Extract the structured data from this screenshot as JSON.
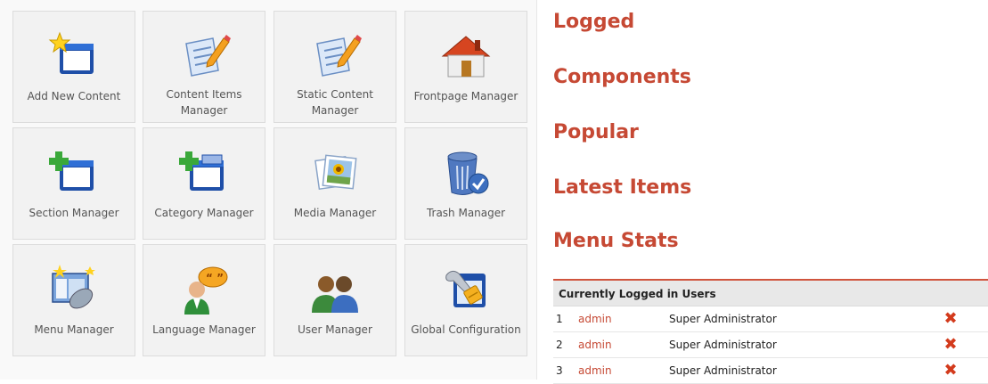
{
  "cpanel": {
    "tiles": [
      {
        "label": "Add New Content",
        "icon": "add-content-icon"
      },
      {
        "label": "Content Items Manager",
        "icon": "content-items-icon"
      },
      {
        "label": "Static Content Manager",
        "icon": "static-content-icon"
      },
      {
        "label": "Frontpage Manager",
        "icon": "frontpage-icon"
      },
      {
        "label": "Section Manager",
        "icon": "section-icon"
      },
      {
        "label": "Category Manager",
        "icon": "category-icon"
      },
      {
        "label": "Media Manager",
        "icon": "media-icon"
      },
      {
        "label": "Trash Manager",
        "icon": "trash-icon"
      },
      {
        "label": "Menu Manager",
        "icon": "menu-icon"
      },
      {
        "label": "Language Manager",
        "icon": "language-icon"
      },
      {
        "label": "User Manager",
        "icon": "user-icon"
      },
      {
        "label": "Global Configuration",
        "icon": "global-config-icon"
      }
    ]
  },
  "modules": {
    "headings": [
      "Logged",
      "Components",
      "Popular",
      "Latest Items",
      "Menu Stats"
    ]
  },
  "logged_table": {
    "title": "Currently Logged in Users",
    "rows": [
      {
        "num": "1",
        "user": "admin",
        "role": "Super Administrator"
      },
      {
        "num": "2",
        "user": "admin",
        "role": "Super Administrator"
      },
      {
        "num": "3",
        "user": "admin",
        "role": "Super Administrator"
      }
    ],
    "kill_icon": "✖"
  },
  "colors": {
    "accent": "#c64934",
    "tile_bg": "#f2f2f2",
    "border": "#dcdcdc"
  }
}
